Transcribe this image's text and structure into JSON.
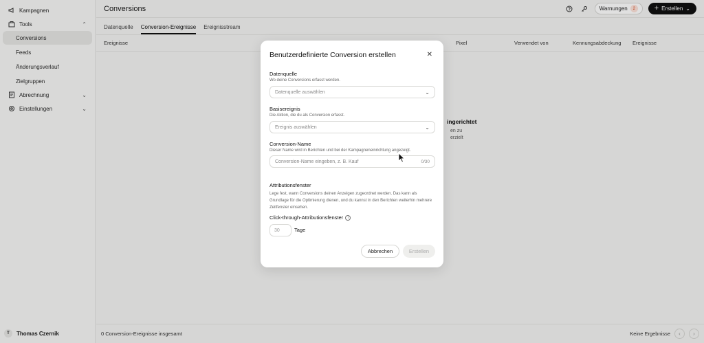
{
  "sidebar": {
    "items": [
      {
        "label": "Kampagnen",
        "icon": "megaphone-icon"
      },
      {
        "label": "Tools",
        "icon": "toolbox-icon",
        "chevron": "⌃"
      },
      {
        "label": "Conversions"
      },
      {
        "label": "Feeds"
      },
      {
        "label": "Änderungsverlauf"
      },
      {
        "label": "Zielgruppen"
      },
      {
        "label": "Abrechnung",
        "icon": "billing-icon",
        "chevron": "⌄"
      },
      {
        "label": "Einstellungen",
        "icon": "settings-icon",
        "chevron": "⌄"
      }
    ],
    "user": {
      "initial": "T",
      "name": "Thomas Czernik"
    }
  },
  "header": {
    "title": "Conversions",
    "warnings_label": "Warnungen",
    "warnings_count": "2",
    "create_label": "Erstellen"
  },
  "tabs": [
    "Datenquelle",
    "Conversion-Ereignisse",
    "Ereignisstream"
  ],
  "table": {
    "columns": [
      "Ereignisse",
      "Pixel",
      "Verwendet von",
      "Kennungsabdeckung",
      "Ereignisse"
    ]
  },
  "empty_state": {
    "title": "ingerichtet",
    "line1": "en zu",
    "line2": "erzielt"
  },
  "footer": {
    "count_text": "0 Conversion-Ereignisse insgesamt",
    "no_results": "Keine Ergebnisse"
  },
  "modal": {
    "title": "Benutzerdefinierte Conversion erstellen",
    "datenquelle": {
      "label": "Datenquelle",
      "desc": "Wo deine Conversions erfasst werden.",
      "placeholder": "Datenquelle auswählen"
    },
    "basisereignis": {
      "label": "Basisereignis",
      "desc": "Die Aktion, die du als Conversion erfasst.",
      "placeholder": "Ereignis auswählen"
    },
    "conversion_name": {
      "label": "Conversion-Name",
      "desc": "Dieser Name wird in Berichten und bei der Kampagneneinrichtung angezeigt.",
      "placeholder": "Conversion-Name eingeben, z. B. Kauf",
      "counter": "0/30"
    },
    "attribution": {
      "label": "Attributionsfenster",
      "desc": "Lege fest, wann Conversions deinen Anzeigen zugeordnet werden. Das kann als Grundlage für die Optimierung dienen, und du kannst in den Berichten weiterhin mehrere Zeitfenster einsehen.",
      "click_label": "Click-through-Attributionsfenster",
      "days_value": "30",
      "days_unit": "Tage"
    },
    "cancel_label": "Abbrechen",
    "create_label": "Erstellen"
  }
}
